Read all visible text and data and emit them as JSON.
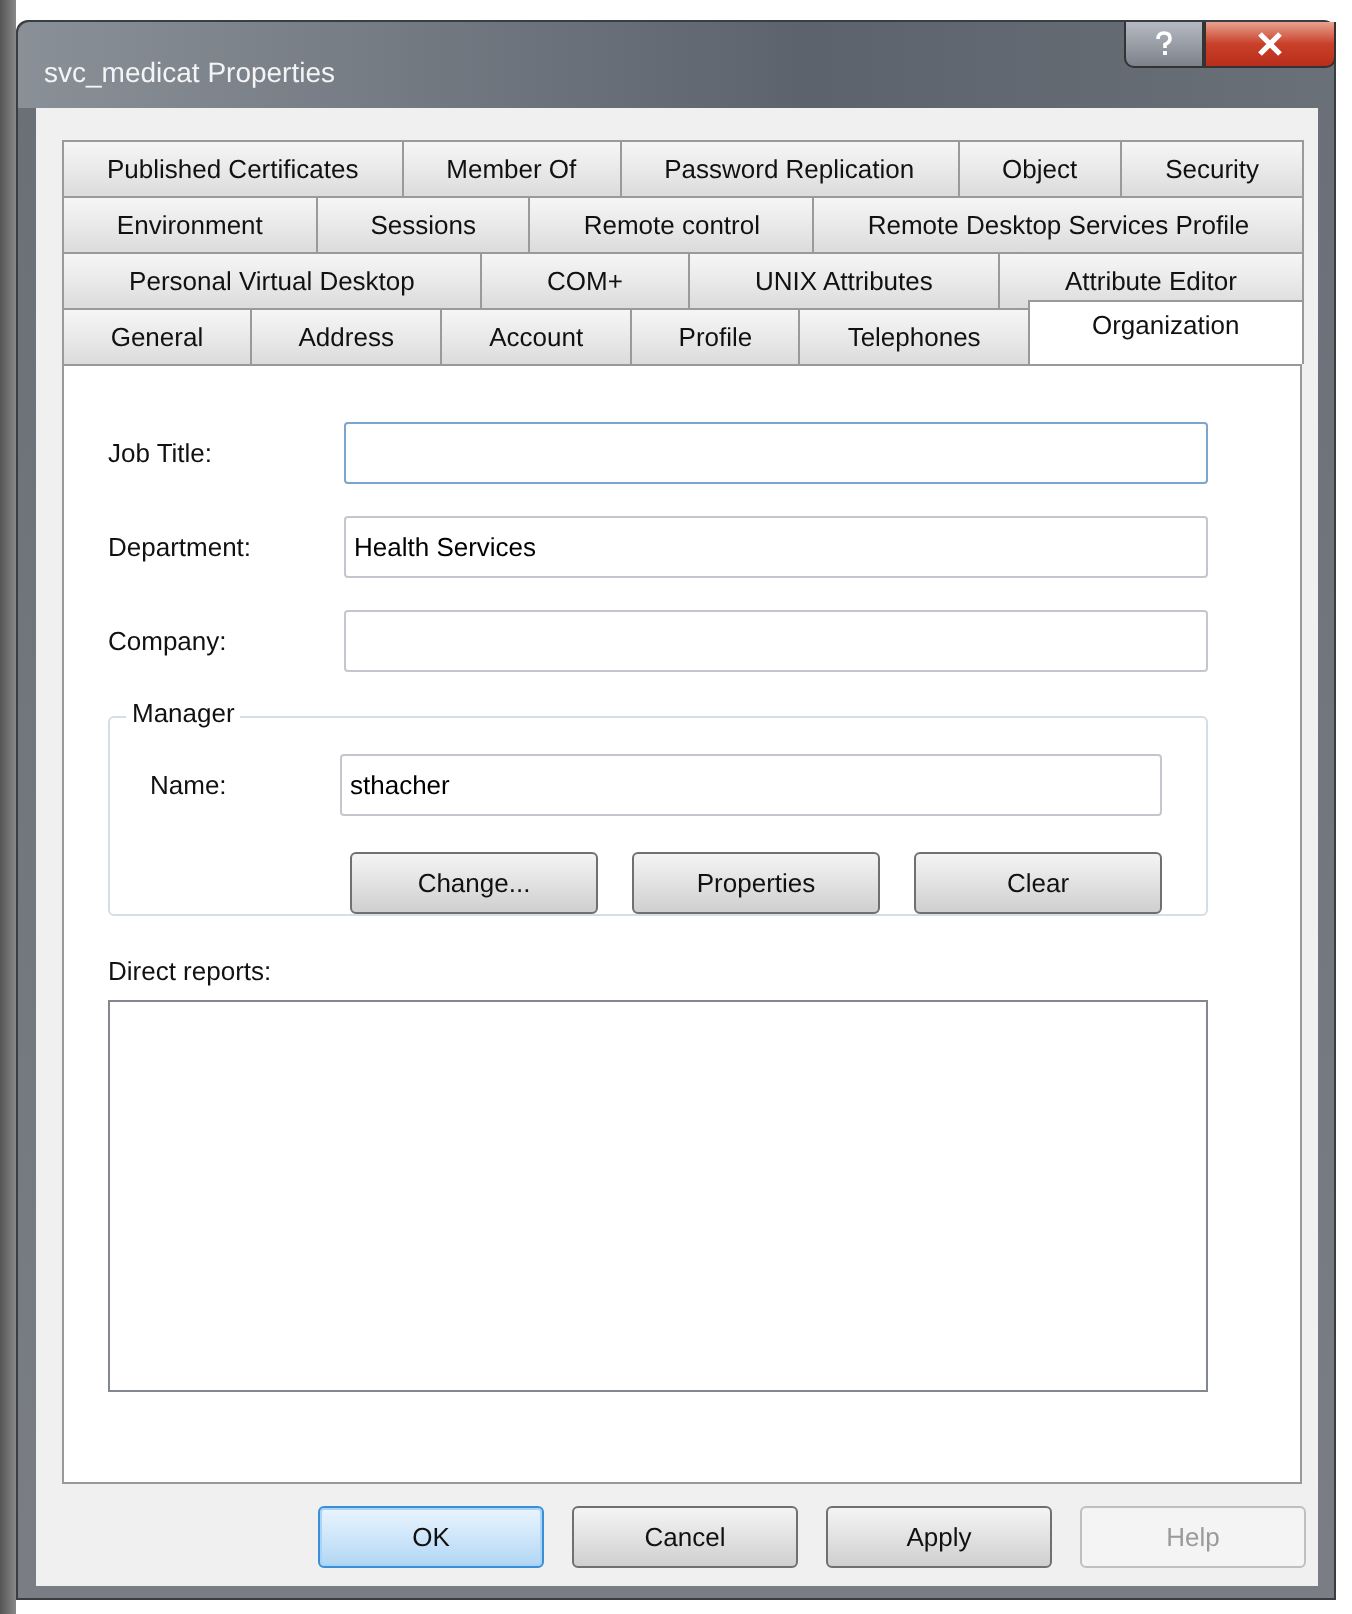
{
  "window": {
    "title": "svc_medicat Properties"
  },
  "title_buttons": [
    {
      "kind": "help"
    },
    {
      "kind": "close"
    }
  ],
  "tab_rows": [
    [
      {
        "label": "Published Certificates",
        "selected": false
      },
      {
        "label": "Member Of",
        "selected": false
      },
      {
        "label": "Password Replication",
        "selected": false
      },
      {
        "label": "Object",
        "selected": false
      },
      {
        "label": "Security",
        "selected": false
      }
    ],
    [
      {
        "label": "Environment",
        "selected": false
      },
      {
        "label": "Sessions",
        "selected": false
      },
      {
        "label": "Remote control",
        "selected": false
      },
      {
        "label": "Remote Desktop Services Profile",
        "selected": false
      }
    ],
    [
      {
        "label": "Personal Virtual Desktop",
        "selected": false
      },
      {
        "label": "COM+",
        "selected": false
      },
      {
        "label": "UNIX Attributes",
        "selected": false
      },
      {
        "label": "Attribute Editor",
        "selected": false
      }
    ],
    [
      {
        "label": "General",
        "selected": false
      },
      {
        "label": "Address",
        "selected": false
      },
      {
        "label": "Account",
        "selected": false
      },
      {
        "label": "Profile",
        "selected": false
      },
      {
        "label": "Telephones",
        "selected": false
      },
      {
        "label": "Organization",
        "selected": true
      }
    ]
  ],
  "fields": [
    {
      "label": "Job Title:",
      "focused": true
    },
    {
      "label": "Department:",
      "value": "Health Services",
      "focused": false
    },
    {
      "label": "Company:",
      "focused": false
    }
  ],
  "manager": {
    "title": "Manager",
    "name_label": "Name:",
    "name_value": "sthacher",
    "buttons": [
      "Change...",
      "Properties",
      "Clear"
    ]
  },
  "direct_reports": {
    "label": "Direct reports:"
  },
  "buttons": [
    {
      "label": "OK",
      "default": true,
      "disabled": false
    },
    {
      "label": "Cancel",
      "default": false,
      "disabled": false
    },
    {
      "label": "Apply",
      "default": false,
      "disabled": false
    },
    {
      "label": "Help",
      "default": false,
      "disabled": true
    }
  ]
}
